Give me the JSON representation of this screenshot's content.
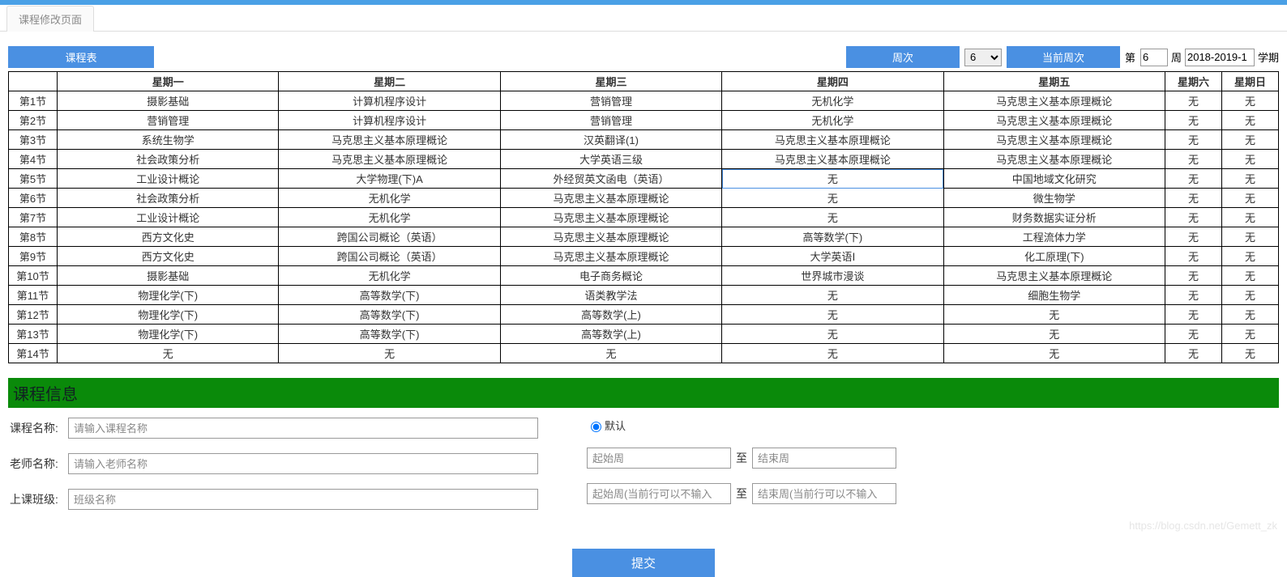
{
  "tab": {
    "title": "课程修改页面"
  },
  "controls": {
    "timetable_btn": "课程表",
    "week_btn": "周次",
    "week_select_value": "6",
    "cur_week_btn": "当前周次",
    "prefix_cur": "第",
    "cur_week_value": "6",
    "suffix_week": "周",
    "semester_value": "2018-2019-1",
    "semester_label": "学期"
  },
  "schedule": {
    "headers": [
      "",
      "星期一",
      "星期二",
      "星期三",
      "星期四",
      "星期五",
      "星期六",
      "星期日"
    ],
    "rows": [
      {
        "period": "第1节",
        "cells": [
          "摄影基础",
          "计算机程序设计",
          "营销管理",
          "无机化学",
          "马克思主义基本原理概论",
          "无",
          "无"
        ]
      },
      {
        "period": "第2节",
        "cells": [
          "营销管理",
          "计算机程序设计",
          "营销管理",
          "无机化学",
          "马克思主义基本原理概论",
          "无",
          "无"
        ]
      },
      {
        "period": "第3节",
        "cells": [
          "系统生物学",
          "马克思主义基本原理概论",
          "汉英翻译(1)",
          "马克思主义基本原理概论",
          "马克思主义基本原理概论",
          "无",
          "无"
        ]
      },
      {
        "period": "第4节",
        "cells": [
          "社会政策分析",
          "马克思主义基本原理概论",
          "大学英语三级",
          "马克思主义基本原理概论",
          "马克思主义基本原理概论",
          "无",
          "无"
        ]
      },
      {
        "period": "第5节",
        "cells": [
          "工业设计概论",
          "大学物理(下)A",
          "外经贸英文函电（英语）",
          "无",
          "中国地域文化研究",
          "无",
          "无"
        ]
      },
      {
        "period": "第6节",
        "cells": [
          "社会政策分析",
          "无机化学",
          "马克思主义基本原理概论",
          "无",
          "微生物学",
          "无",
          "无"
        ]
      },
      {
        "period": "第7节",
        "cells": [
          "工业设计概论",
          "无机化学",
          "马克思主义基本原理概论",
          "无",
          "财务数据实证分析",
          "无",
          "无"
        ]
      },
      {
        "period": "第8节",
        "cells": [
          "西方文化史",
          "跨国公司概论（英语）",
          "马克思主义基本原理概论",
          "高等数学(下)",
          "工程流体力学",
          "无",
          "无"
        ]
      },
      {
        "period": "第9节",
        "cells": [
          "西方文化史",
          "跨国公司概论（英语）",
          "马克思主义基本原理概论",
          "大学英语Ⅰ",
          "化工原理(下)",
          "无",
          "无"
        ]
      },
      {
        "period": "第10节",
        "cells": [
          "摄影基础",
          "无机化学",
          "电子商务概论",
          "世界城市漫谈",
          "马克思主义基本原理概论",
          "无",
          "无"
        ]
      },
      {
        "period": "第11节",
        "cells": [
          "物理化学(下)",
          "高等数学(下)",
          "语类教学法",
          "无",
          "细胞生物学",
          "无",
          "无"
        ]
      },
      {
        "period": "第12节",
        "cells": [
          "物理化学(下)",
          "高等数学(下)",
          "高等数学(上)",
          "无",
          "无",
          "无",
          "无"
        ]
      },
      {
        "period": "第13节",
        "cells": [
          "物理化学(下)",
          "高等数学(下)",
          "高等数学(上)",
          "无",
          "无",
          "无",
          "无"
        ]
      },
      {
        "period": "第14节",
        "cells": [
          "无",
          "无",
          "无",
          "无",
          "无",
          "无",
          "无"
        ]
      }
    ],
    "selected": {
      "row": 4,
      "col": 3
    }
  },
  "section_info_title": "课程信息",
  "form": {
    "course_name_label": "课程名称:",
    "course_name_placeholder": "请输入课程名称",
    "teacher_label": "老师名称:",
    "teacher_placeholder": "请输入老师名称",
    "class_label": "上课班级:",
    "class_placeholder": "班级名称",
    "default_radio_label": "默认",
    "start_week_placeholder": "起始周",
    "range_sep": "至",
    "end_week_placeholder": "结束周",
    "start_week2_placeholder": "起始周(当前行可以不输入",
    "end_week2_placeholder": "结束周(当前行可以不输入",
    "submit_label": "提交"
  },
  "watermark": "https://blog.csdn.net/Gemett_zk"
}
